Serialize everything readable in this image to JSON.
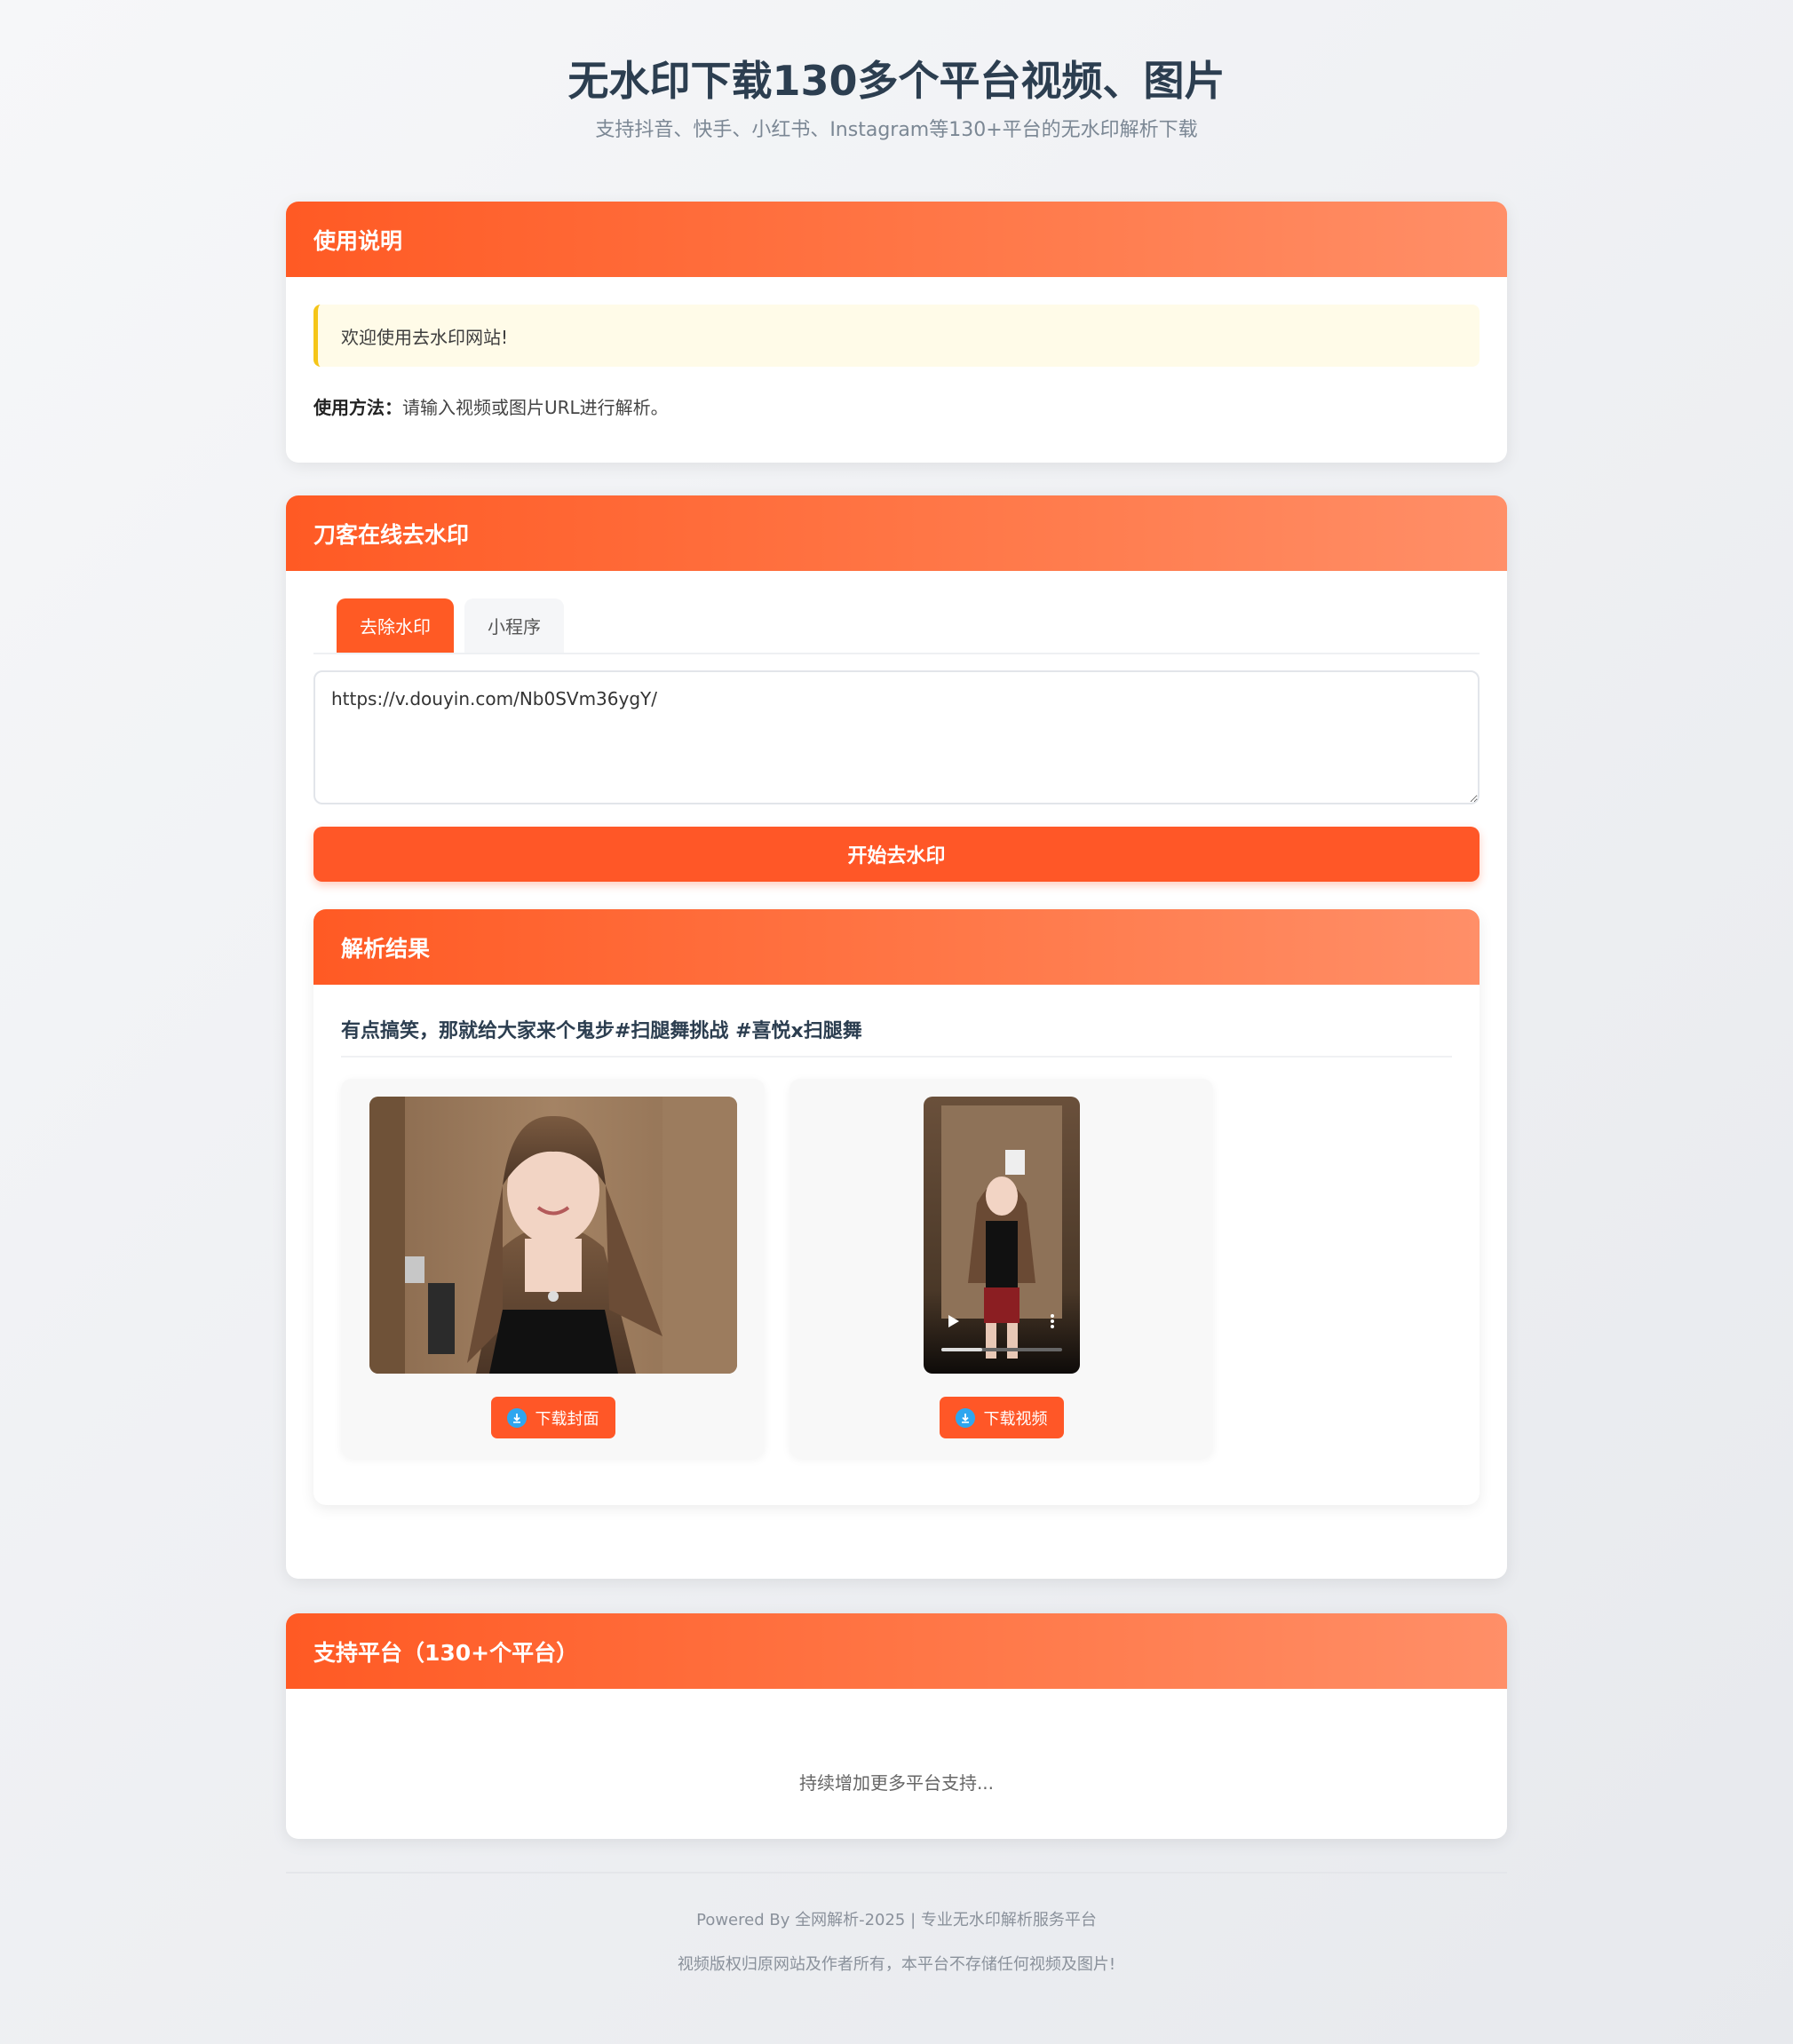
{
  "header": {
    "title": "无水印下载130多个平台视频、图片",
    "subtitle": "支持抖音、快手、小红书、Instagram等130+平台的无水印解析下载"
  },
  "usage_card": {
    "title": "使用说明",
    "notice": "欢迎使用去水印网站!",
    "method_label": "使用方法：",
    "method_text": "请输入视频或图片URL进行解析。"
  },
  "tool_card": {
    "title": "刀客在线去水印",
    "tabs": [
      {
        "label": "去除水印",
        "active": true
      },
      {
        "label": "小程序",
        "active": false
      }
    ],
    "url_value": "https://v.douyin.com/Nb0SVm36ygY/",
    "start_button": "开始去水印",
    "result": {
      "title": "解析结果",
      "video_title": "有点搞笑，那就给大家来个鬼步#扫腿舞挑战 #喜悦x扫腿舞",
      "items": [
        {
          "button": "下载封面",
          "icon": "download-icon"
        },
        {
          "button": "下载视频",
          "icon": "download-icon"
        }
      ]
    }
  },
  "platform_card": {
    "title": "支持平台（130+个平台）",
    "note": "持续增加更多平台支持..."
  },
  "footer": {
    "line1": "Powered By 全网解析-2025 | 专业无水印解析服务平台",
    "line2": "视频版权归原网站及作者所有，本平台不存储任何视频及图片!"
  },
  "colors": {
    "accent": "#ff5a24",
    "accent_light": "#ff8f68",
    "notice_bg": "#fffbe8",
    "notice_border": "#f5c518",
    "title_text": "#2c3e50"
  }
}
